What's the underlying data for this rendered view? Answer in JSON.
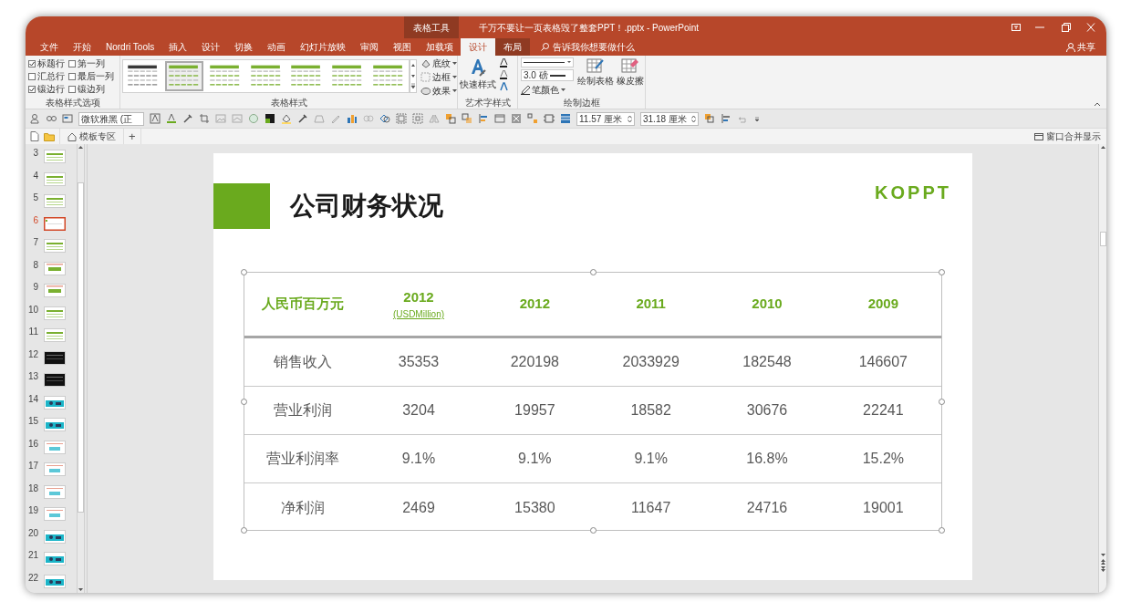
{
  "window": {
    "title": "千万不要让一页表格毁了整套PPT！.pptx  -  PowerPoint",
    "context_group": "表格工具"
  },
  "ribbon_tabs": [
    {
      "label": "文件",
      "selected": false,
      "kind": "normal"
    },
    {
      "label": "开始",
      "selected": false,
      "kind": "normal"
    },
    {
      "label": "Nordri Tools",
      "selected": false,
      "kind": "normal"
    },
    {
      "label": "插入",
      "selected": false,
      "kind": "normal"
    },
    {
      "label": "设计",
      "selected": false,
      "kind": "normal"
    },
    {
      "label": "切换",
      "selected": false,
      "kind": "normal"
    },
    {
      "label": "动画",
      "selected": false,
      "kind": "normal"
    },
    {
      "label": "幻灯片放映",
      "selected": false,
      "kind": "normal"
    },
    {
      "label": "审阅",
      "selected": false,
      "kind": "normal"
    },
    {
      "label": "视图",
      "selected": false,
      "kind": "normal"
    },
    {
      "label": "加载项",
      "selected": false,
      "kind": "normal"
    },
    {
      "label": "设计",
      "selected": true,
      "kind": "contextual"
    },
    {
      "label": "布局",
      "selected": false,
      "kind": "contextual"
    }
  ],
  "tell_me": "告诉我你想要做什么",
  "share": "共享",
  "style_options": {
    "label": "表格样式选项",
    "checkboxes": [
      {
        "label": "标题行",
        "checked": true
      },
      {
        "label": "第一列",
        "checked": false
      },
      {
        "label": "汇总行",
        "checked": false
      },
      {
        "label": "最后一列",
        "checked": false
      },
      {
        "label": "镶边行",
        "checked": true
      },
      {
        "label": "镶边列",
        "checked": false
      }
    ]
  },
  "table_styles": {
    "label": "表格样式",
    "styles": [
      {
        "color": "#3a3a3a",
        "selected": false
      },
      {
        "color": "#7ab030",
        "selected": true
      },
      {
        "color": "#7ab030",
        "selected": false
      },
      {
        "color": "#7ab030",
        "selected": false
      },
      {
        "color": "#7ab030",
        "selected": false
      },
      {
        "color": "#7ab030",
        "selected": false
      },
      {
        "color": "#7ab030",
        "selected": false
      }
    ],
    "buttons": [
      "底纹",
      "边框",
      "效果"
    ]
  },
  "wordart": {
    "label": "艺术字样式",
    "quick_styles": "快速样式"
  },
  "draw_borders": {
    "label": "绘制边框",
    "pen_weight": "3.0 磅",
    "pen_color": "笔颜色",
    "draw_table": "绘制表格",
    "eraser": "橡皮擦"
  },
  "toolbar": {
    "font": "微软雅黑 (正",
    "height": "11.57 厘米",
    "width": "31.18 厘米"
  },
  "doc_tabs": [
    {
      "label": "模板专区"
    }
  ],
  "new_tab": "+",
  "merge_windows": "窗口合并显示",
  "slides": [
    {
      "number": "3",
      "selected": false,
      "kind": "green"
    },
    {
      "number": "4",
      "selected": false,
      "kind": "green"
    },
    {
      "number": "5",
      "selected": false,
      "kind": "green"
    },
    {
      "number": "6",
      "selected": true,
      "kind": "plain"
    },
    {
      "number": "7",
      "selected": false,
      "kind": "green"
    },
    {
      "number": "8",
      "selected": false,
      "kind": "salmon"
    },
    {
      "number": "9",
      "selected": false,
      "kind": "salmon"
    },
    {
      "number": "10",
      "selected": false,
      "kind": "green"
    },
    {
      "number": "11",
      "selected": false,
      "kind": "green"
    },
    {
      "number": "12",
      "selected": false,
      "kind": "dark"
    },
    {
      "number": "13",
      "selected": false,
      "kind": "dark"
    },
    {
      "number": "14",
      "selected": false,
      "kind": "photo"
    },
    {
      "number": "15",
      "selected": false,
      "kind": "photo"
    },
    {
      "number": "16",
      "selected": false,
      "kind": "teal"
    },
    {
      "number": "17",
      "selected": false,
      "kind": "teal"
    },
    {
      "number": "18",
      "selected": false,
      "kind": "teal"
    },
    {
      "number": "19",
      "selected": false,
      "kind": "teal"
    },
    {
      "number": "20",
      "selected": false,
      "kind": "photo"
    },
    {
      "number": "21",
      "selected": false,
      "kind": "photo"
    },
    {
      "number": "22",
      "selected": false,
      "kind": "photo"
    }
  ],
  "slide": {
    "title": "公司财务状况",
    "logo": "KOPPT",
    "table": {
      "columns": [
        {
          "label": "人民币百万元"
        },
        {
          "label": "2012",
          "sublabel": "(USDMillion)"
        },
        {
          "label": "2012"
        },
        {
          "label": "2011"
        },
        {
          "label": "2010"
        },
        {
          "label": "2009"
        }
      ],
      "rows": [
        {
          "label": "销售收入",
          "values": [
            "35353",
            "220198",
            "2033929",
            "182548",
            "146607"
          ]
        },
        {
          "label": "营业利润",
          "values": [
            "3204",
            "19957",
            "18582",
            "30676",
            "22241"
          ]
        },
        {
          "label": "营业利润率",
          "values": [
            "9.1%",
            "9.1%",
            "9.1%",
            "16.8%",
            "15.2%"
          ]
        },
        {
          "label": "净利润",
          "values": [
            "2469",
            "15380",
            "11647",
            "24716",
            "19001"
          ]
        }
      ]
    }
  }
}
